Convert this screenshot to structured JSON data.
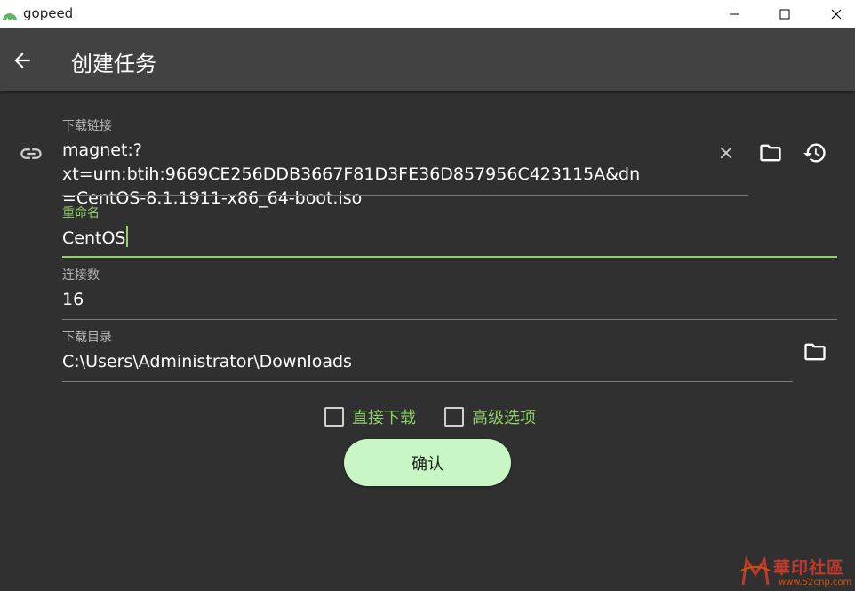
{
  "window": {
    "app_name": "gopeed"
  },
  "appbar": {
    "title": "创建任务"
  },
  "fields": {
    "url": {
      "label": "下载链接",
      "value_line1": "magnet:?xt=urn:btih:9669CE256DDB3667F81D3FE36D857956C423115A&dn",
      "value_line2": "=CentOS-8.1.1911-x86_64-boot.iso"
    },
    "rename": {
      "label": "重命名",
      "value": "CentOS"
    },
    "connections": {
      "label": "连接数",
      "value": "16"
    },
    "directory": {
      "label": "下载目录",
      "value": "C:\\Users\\Administrator\\Downloads"
    }
  },
  "options": {
    "direct_download": {
      "label": "直接下载",
      "checked": false
    },
    "advanced": {
      "label": "高级选项",
      "checked": false
    }
  },
  "confirm_label": "确认",
  "watermark": {
    "text": "華印社區",
    "url": "www.52cnp.com"
  },
  "colors": {
    "background": "#303030",
    "appbar": "#424242",
    "accent": "#8fd06b",
    "button": "#c8f7c5"
  }
}
